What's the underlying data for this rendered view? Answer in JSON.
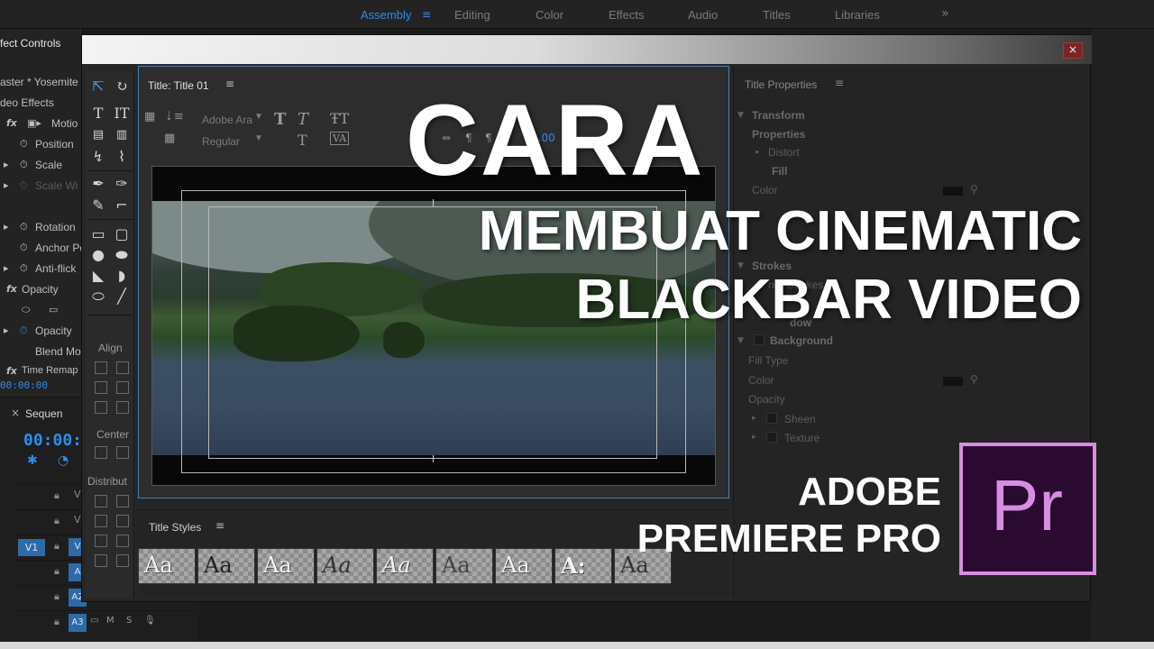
{
  "workspace": {
    "tabs": [
      "Assembly",
      "Editing",
      "Color",
      "Effects",
      "Audio",
      "Titles",
      "Libraries"
    ],
    "active_tab": "Assembly",
    "menu_icon": "hamburger-menu-icon",
    "more": "»"
  },
  "effect_controls": {
    "title": "fect Controls",
    "source": "aster * Yosemite",
    "section": "deo Effects",
    "rows": {
      "motion": "Motio",
      "position": "Position",
      "scale": "Scale",
      "scale_width": "Scale Wi",
      "rotation": "Rotation",
      "anchor": "Anchor Po",
      "antiflicker": "Anti-flick",
      "opacity_fx": "Opacity",
      "opacity": "Opacity",
      "blend": "Blend Mo",
      "time_remap": "Time Remap"
    },
    "timecode": "00:00:00"
  },
  "sequence": {
    "tab": "Sequen",
    "close": "×",
    "timecode": "00:00:0",
    "tracks": [
      {
        "label": "",
        "target": "V"
      },
      {
        "label": "",
        "target": "V"
      },
      {
        "label": "V1",
        "target": "V"
      },
      {
        "label": "",
        "target": "A"
      },
      {
        "label": "",
        "target": "A2"
      },
      {
        "label": "",
        "target": "A3"
      }
    ],
    "controls": {
      "m": "M",
      "s": "S"
    }
  },
  "title_window": {
    "close": "×",
    "pane_name": "Title: Title 01",
    "font_family": "Adobe Ara",
    "font_style": "Regular",
    "value_readout": "0.00",
    "align_label": "Align",
    "center_label": "Center",
    "distribute_label": "Distribut",
    "styles_title": "Title Styles",
    "style_samples": [
      "Aa",
      "Aa",
      "Aa",
      "Aa",
      "Aa",
      "Aa",
      "Aa",
      "A:",
      "Aa"
    ]
  },
  "title_properties": {
    "title": "Title Properties",
    "transform": "Transform",
    "properties": "Properties",
    "distort": "Distort",
    "fill": "Fill",
    "color": "Color",
    "strokes": "Strokes",
    "inner_strokes": "ner Strokes",
    "shadow": "dow",
    "background": "Background",
    "fill_type": "Fill Type",
    "bg_color": "Color",
    "opacity": "Opacity",
    "sheen": "Sheen",
    "texture": "Texture"
  },
  "headline": {
    "line1": "CARA",
    "line2": "MEMBUAT CINEMATIC",
    "line3": "BLACKBAR VIDEO",
    "product1": "ADOBE",
    "product2": "PREMIERE PRO"
  },
  "logo": {
    "text": "Pr",
    "color": "#d78de2",
    "bg": "#2a0a30"
  },
  "colors": {
    "accent": "#2d8ceb",
    "panel": "#232323"
  }
}
